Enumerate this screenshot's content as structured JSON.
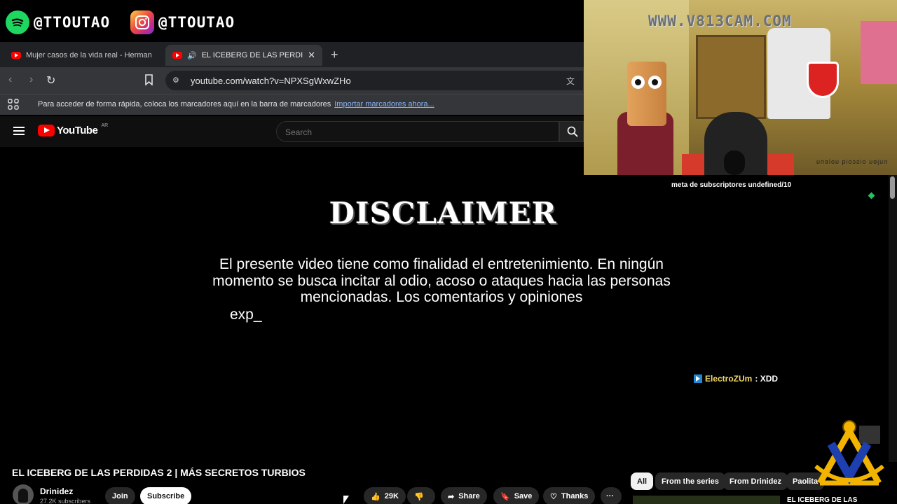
{
  "social": {
    "spotify_handle": "@TTOUTAO",
    "instagram_handle": "@TTOUTAO"
  },
  "browser": {
    "tabs": [
      {
        "label": "Mujer casos de la vida real - Herman"
      },
      {
        "label": "EL ICEBERG DE LAS PERDIDAS"
      }
    ],
    "new_tab": "+",
    "url": "youtube.com/watch?v=NPXSgWxwZHo",
    "bookmarks_hint": "Para acceder de forma rápida, coloca los marcadores aquí en la barra de marcadores",
    "bookmarks_link": "Importar marcadores ahora..."
  },
  "youtube": {
    "logo_text": "YouTube",
    "logo_sup": "AR",
    "search_placeholder": "Search"
  },
  "video": {
    "heading": "DISCLAIMER",
    "body": "El presente video tiene como finalidad el entretenimiento. En ningún momento se busca incitar al odio, acoso o ataques hacia las personas mencionadas. Los comentarios y opiniones",
    "tail": "exp_"
  },
  "overlay": {
    "cam_watermark": "WWW.V813CAM.COM",
    "cam_mirror_text": "nujeu oiscoiq uolenu",
    "goal": "meta de subscriptores undefined/10",
    "chat_user": "ElectroZUm",
    "chat_message": " : XDD"
  },
  "below": {
    "title": "EL ICEBERG DE LAS PERDIDAS 2 | MÁS SECRETOS TURBIOS",
    "channel_name": "Drinidez",
    "channel_subs": "27.2K subscribers",
    "join": "Join",
    "subscribe": "Subscribe",
    "likes": "29K",
    "share": "Share",
    "save": "Save",
    "thanks": "Thanks",
    "more": "···",
    "chips": [
      "All",
      "From the series",
      "From Drinidez",
      "Paolita"
    ],
    "rec_title": "EL ICEBERG DE LAS"
  },
  "colors": {
    "youtube_red": "#ff0000",
    "spotify_green": "#1ed760",
    "link_blue": "#8ab4f8",
    "chat_gold": "#f3d96b"
  }
}
